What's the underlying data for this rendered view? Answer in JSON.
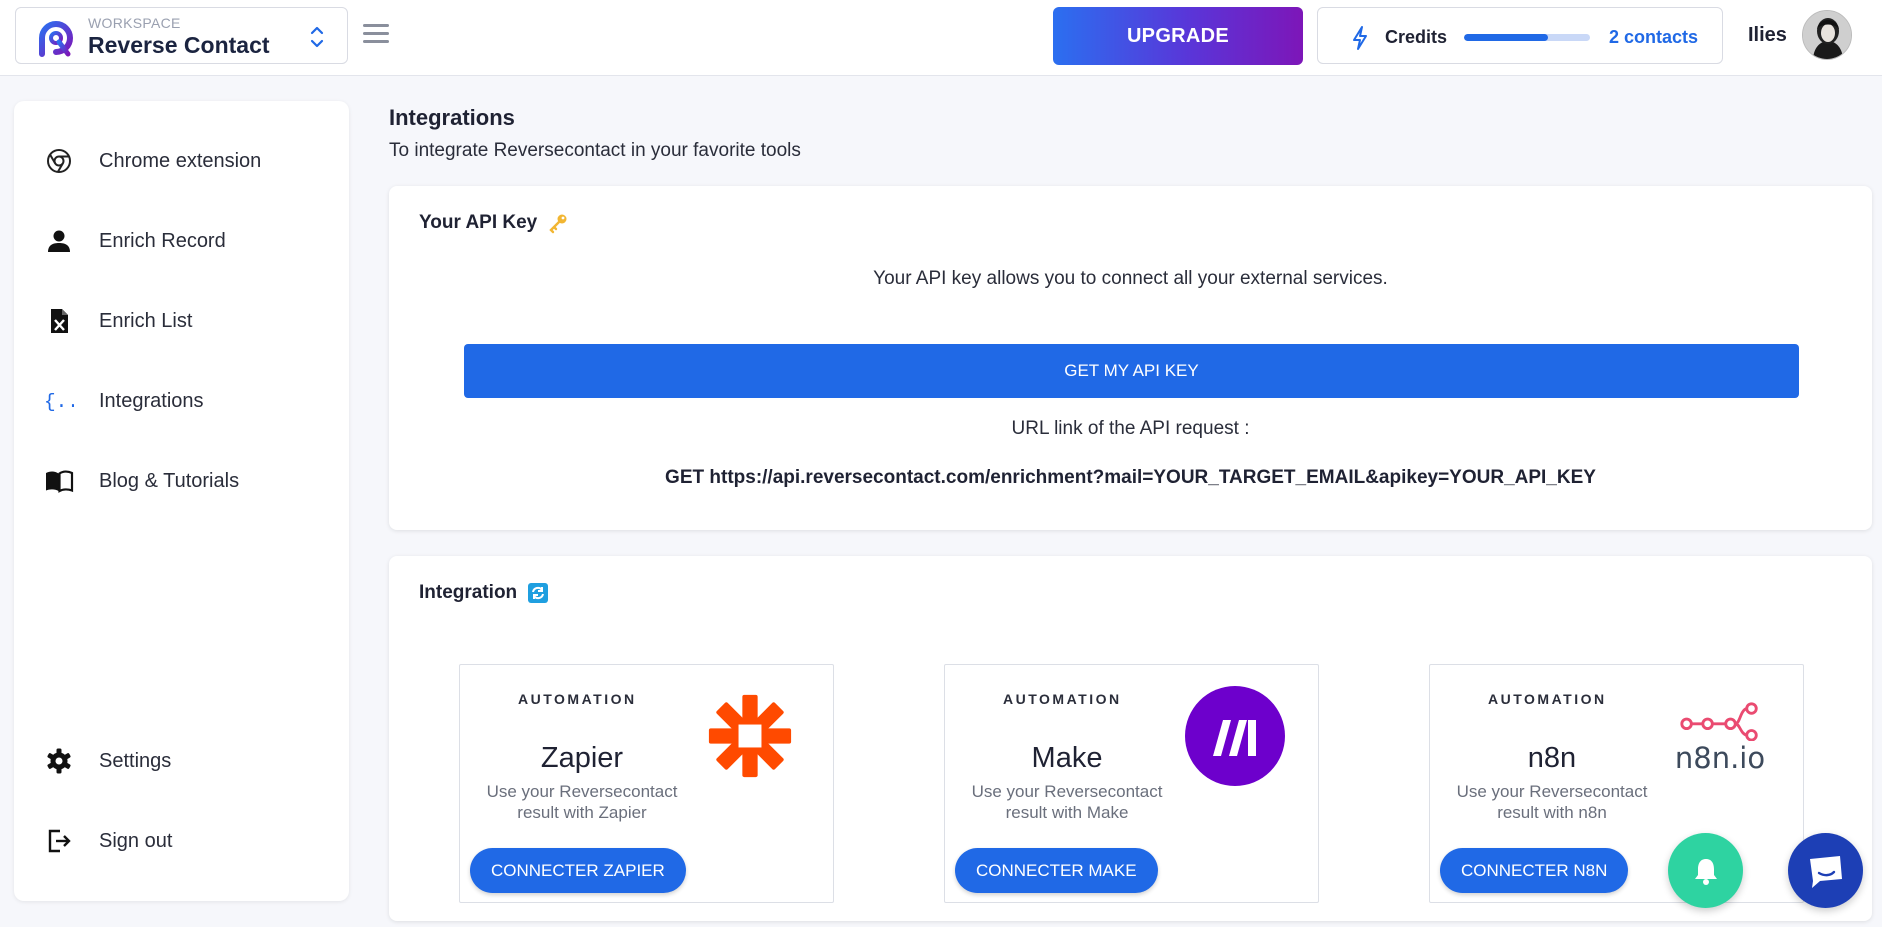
{
  "header": {
    "workspace_kicker": "WORKSPACE",
    "workspace_name": "Reverse Contact",
    "upgrade_label": "UPGRADE",
    "credits_label": "Credits",
    "credits_fill_fraction": 0.67,
    "credits_count": "2 contacts",
    "user_name": "Ilies",
    "brand_color": "#2069e6"
  },
  "sidebar": {
    "items": [
      {
        "label": "Chrome extension",
        "icon": "chrome-icon"
      },
      {
        "label": "Enrich Record",
        "icon": "person-icon"
      },
      {
        "label": "Enrich List",
        "icon": "excel-file-icon"
      },
      {
        "label": "Integrations",
        "icon": "curly-braces-icon"
      },
      {
        "label": "Blog & Tutorials",
        "icon": "book-icon"
      }
    ],
    "bottom_items": [
      {
        "label": "Settings",
        "icon": "gear-icon"
      },
      {
        "label": "Sign out",
        "icon": "sign-out-icon"
      }
    ]
  },
  "main": {
    "title": "Integrations",
    "subtitle": "To integrate Reversecontact in your favorite tools",
    "api_card": {
      "title": "Your API Key",
      "title_icon": "key-icon",
      "description": "Your API key allows you to connect all your external services.",
      "button_label": "GET MY API KEY",
      "url_label": "URL link of the API request :",
      "url": "GET https://api.reversecontact.com/enrichment?mail=YOUR_TARGET_EMAIL&apikey=YOUR_API_KEY"
    },
    "integration_card": {
      "title": "Integration",
      "title_icon": "refresh-icon",
      "tiles": [
        {
          "kicker": "AUTOMATION",
          "name": "Zapier",
          "desc_line1": "Use your Reversecontact",
          "desc_line2": "result with Zapier",
          "button": "CONNECTER ZAPIER",
          "logo": "zapier-logo"
        },
        {
          "kicker": "AUTOMATION",
          "name": "Make",
          "desc_line1": "Use your Reversecontact",
          "desc_line2": "result with Make",
          "button": "CONNECTER MAKE",
          "logo": "make-logo"
        },
        {
          "kicker": "AUTOMATION",
          "name": "n8n",
          "desc_line1": "Use your Reversecontact",
          "desc_line2": "result with n8n",
          "button": "CONNECTER N8N",
          "logo": "n8n-logo",
          "logo_text": "n8n.io"
        }
      ]
    }
  },
  "floating": {
    "bell_icon": "bell-icon",
    "chat_icon": "chat-icon"
  }
}
